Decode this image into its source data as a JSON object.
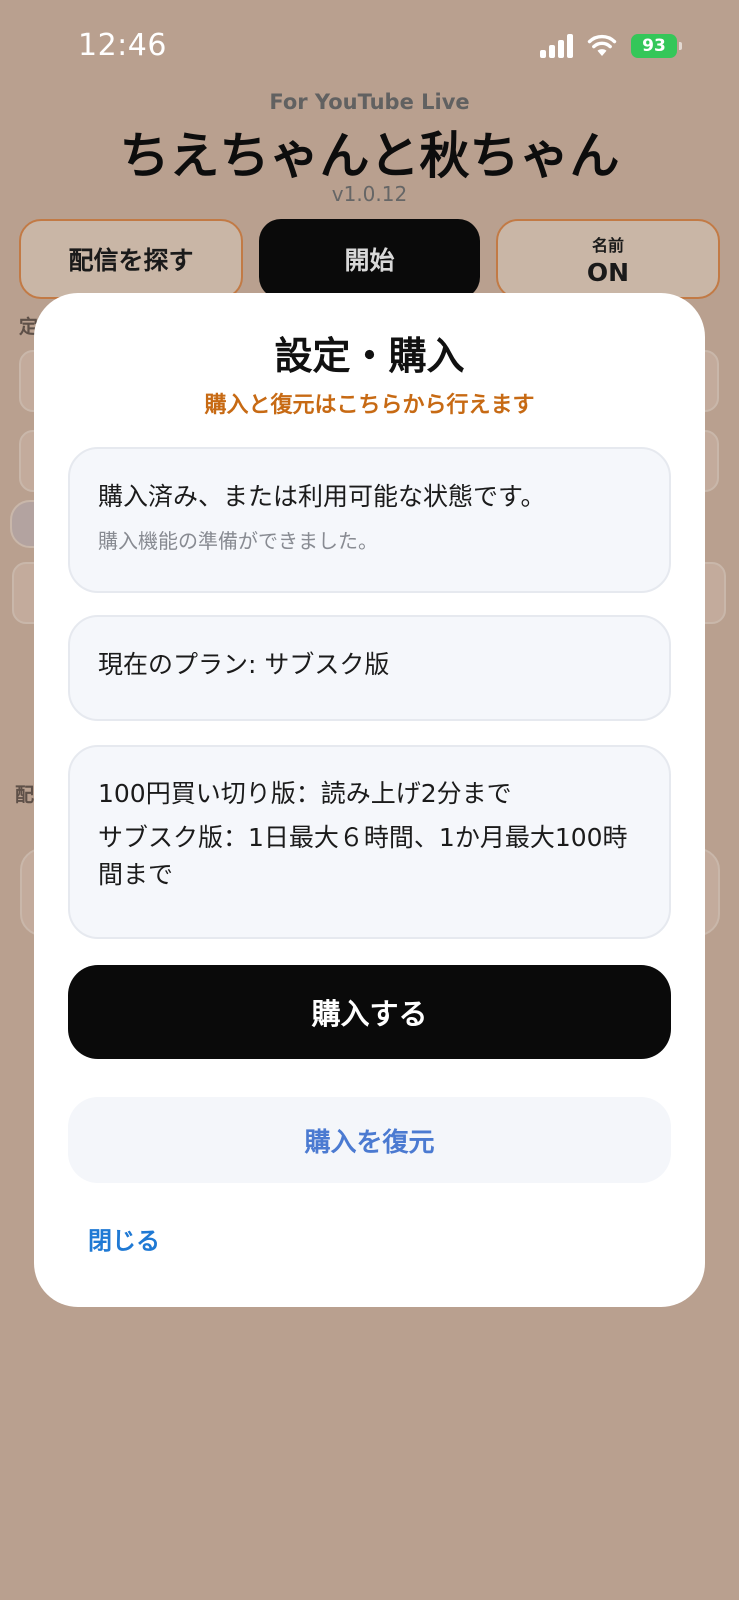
{
  "status_bar": {
    "time": "12:46",
    "battery": "93",
    "icons": [
      "signal-icon",
      "wifi-icon",
      "battery-charging-icon"
    ]
  },
  "app": {
    "subtitle": "For YouTube Live",
    "title": "ちえちゃんと秋ちゃん",
    "version": "v1.0.12",
    "buttons": {
      "search": "配信を探す",
      "start": "開始",
      "name_label": "名前",
      "name_value": "ON"
    },
    "background_labels": {
      "section_1": "定",
      "section_2": "配"
    }
  },
  "modal": {
    "title": "設定・購入",
    "subtitle": "購入と復元はこちらから行えます",
    "status_card": {
      "main": "購入済み、または利用可能な状態です。",
      "sub": "購入機能の準備ができました。"
    },
    "plan_card": {
      "text": "現在のプラン: サブスク版"
    },
    "info_card": {
      "line1": "100円買い切り版：読み上げ2分まで",
      "line2": "サブスク版：1日最大６時間、1か月最大100時間まで"
    },
    "purchase_button": "購入する",
    "restore_button": "購入を復元",
    "close_link": "閉じる"
  },
  "colors": {
    "background": "#b9a08f",
    "accent_orange": "#c76a14",
    "restore_blue": "#4b7ad1",
    "close_blue": "#1f79d4",
    "battery_green": "#34c759"
  }
}
